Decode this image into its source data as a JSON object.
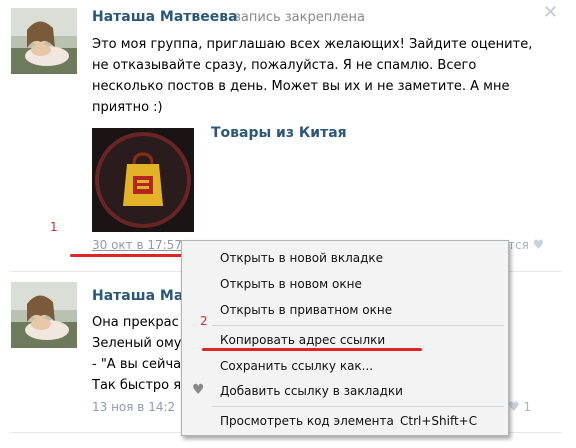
{
  "post1": {
    "author": "Наташа Матвеева",
    "pinned": "запись закреплена",
    "close": "✕",
    "text_lines": [
      "Это моя группа, приглашаю всех желающих! Зайдите оцените,",
      "не отказывайте сразу, пожалуйста. Я не спамлю. Всего",
      "несколько постов в день. Может вы их и не заметите. А мне",
      "приятно :)"
    ],
    "group_link": "Товары из Китая",
    "date": "30 окт в 17:57",
    "like_text": "тся"
  },
  "post2": {
    "author": "Наташа Матв",
    "text_lines": [
      "Она прекрас",
      "Зеленый ому",
      "- \"А вы сейча",
      "Так быстро я"
    ],
    "date": "13 ноя в 14:2",
    "like_count": "1"
  },
  "annotations": {
    "n1": "1",
    "n2": "2",
    "colors": {
      "red": "#e02323"
    }
  },
  "context_menu": {
    "items": [
      "Открыть в новой вкладке",
      "Открыть в новом окне",
      "Открыть в приватном окне",
      "Копировать адрес ссылки",
      "Сохранить ссылку как...",
      "Добавить ссылку в закладки",
      "Просмотреть код элемента"
    ],
    "shortcut": "Ctrl+Shift+C"
  },
  "colors": {
    "link": "#2b587a",
    "meta": "#8f9bab",
    "menu_bg": "#f3f3f3"
  }
}
